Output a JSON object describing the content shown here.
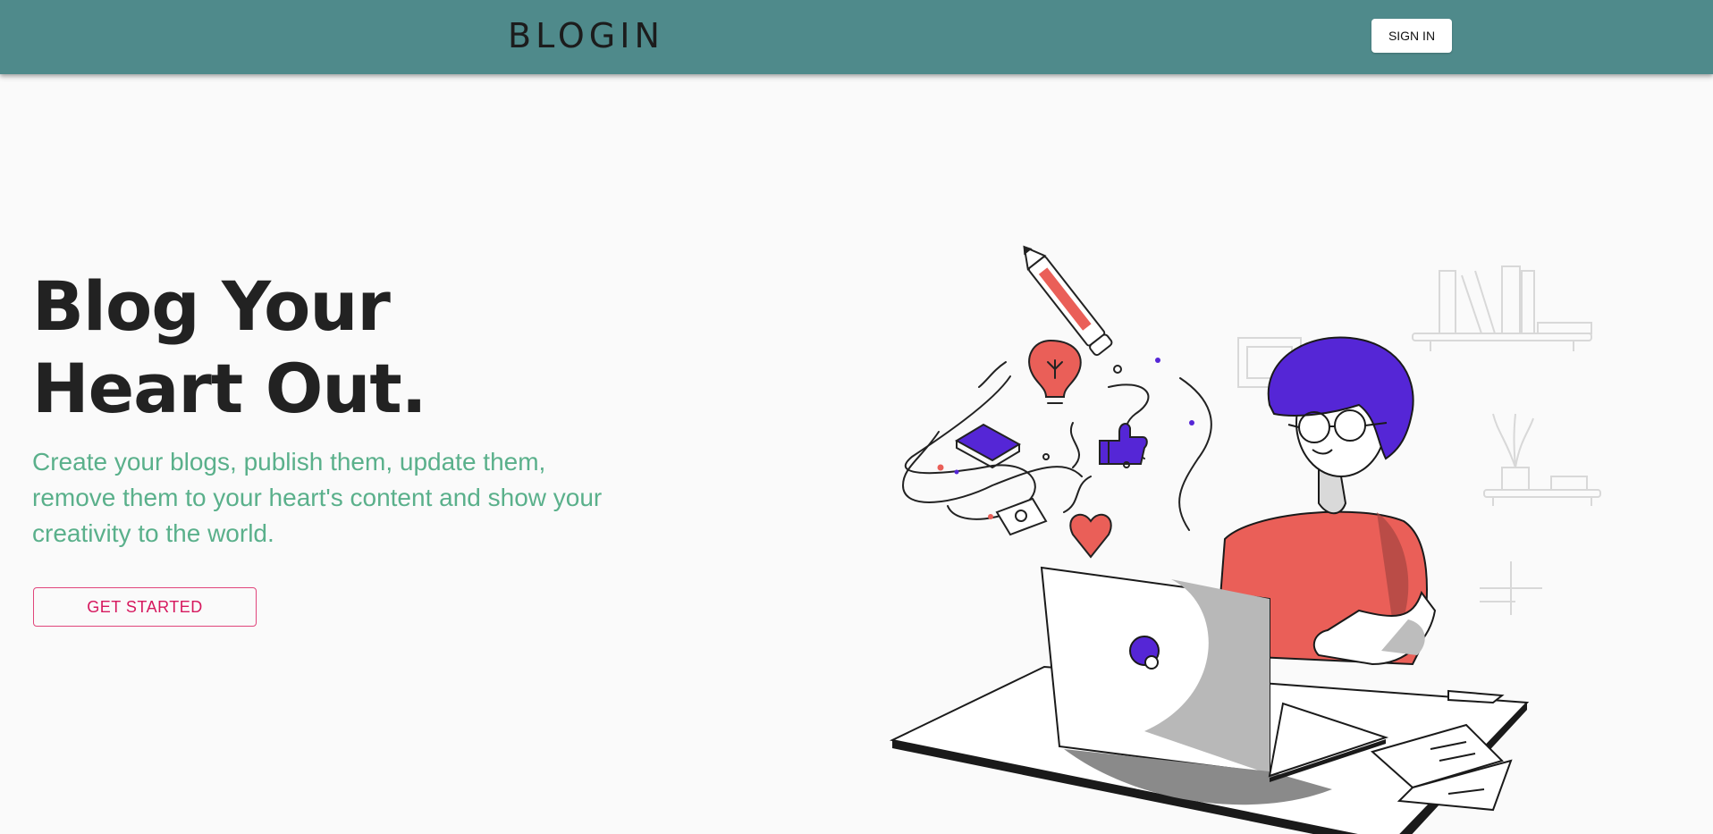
{
  "header": {
    "brand": "BLOGIN",
    "signin_label": "SIGN IN"
  },
  "hero": {
    "headline": "Blog Your Heart Out.",
    "subtitle": "Create your blogs, publish them, update them, remove them to your heart's content and show your creativity to the world.",
    "cta_label": "GET STARTED"
  },
  "colors": {
    "appbar": "#4f8a8b",
    "headline": "#222222",
    "subtitle": "#5ab08b",
    "cta": "#d6185e",
    "accent_purple": "#5526d6",
    "accent_red": "#ea5f58"
  }
}
